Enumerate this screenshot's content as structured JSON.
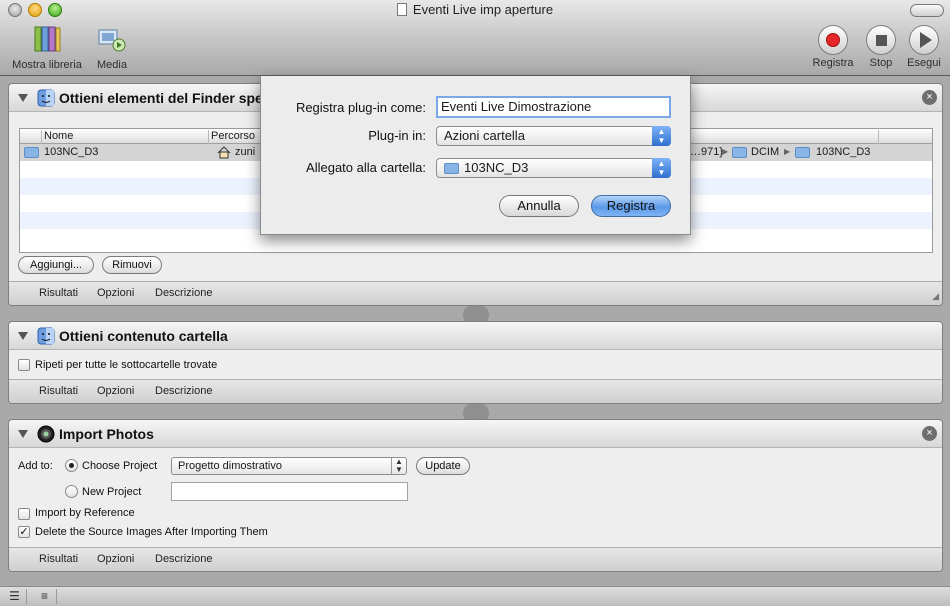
{
  "window": {
    "title": "Eventi Live imp aperture"
  },
  "toolbar": {
    "library_label": "Mostra libreria",
    "media_label": "Media",
    "record_label": "Registra",
    "stop_label": "Stop",
    "run_label": "Esegui"
  },
  "actions": [
    {
      "title": "Ottieni elementi del Finder specificati",
      "columns": [
        "Nome",
        "Percorso"
      ],
      "rows": [
        {
          "name": "103NC_D3",
          "path_start": "zuni",
          "path_mid": "…971}",
          "path_folder1": "DCIM",
          "path_folder2": "103NC_D3"
        }
      ],
      "add_button": "Aggiungi...",
      "remove_button": "Rimuovi"
    },
    {
      "title": "Ottieni contenuto cartella",
      "repeat_label": "Ripeti per tutte le sottocartelle trovate",
      "repeat_checked": false
    },
    {
      "title": "Import Photos",
      "add_to_label": "Add to:",
      "choose_project_label": "Choose Project",
      "project_value": "Progetto dimostrativo",
      "update_button": "Update",
      "new_project_label": "New Project",
      "new_project_value": "",
      "import_by_reference_label": "Import by Reference",
      "delete_source_label": "Delete the Source Images After Importing Them"
    }
  ],
  "footer_tabs": {
    "results": "Risultati",
    "options": "Opzioni",
    "description": "Descrizione"
  },
  "dialog": {
    "name_label": "Registra plug-in come:",
    "name_value": "Eventi Live Dimostrazione",
    "plugin_label": "Plug-in in:",
    "plugin_value": "Azioni cartella",
    "attached_label": "Allegato alla cartella:",
    "attached_value": "103NC_D3",
    "cancel_button": "Annulla",
    "save_button": "Registra"
  },
  "icons": {
    "library": "library-books-icon",
    "media": "media-icon",
    "record": "record-icon",
    "stop": "stop-icon",
    "run": "play-icon",
    "finder": "finder-icon",
    "photos": "aperture-lens-icon",
    "folder": "folder-icon",
    "home": "home-icon"
  },
  "colors": {
    "record_red": "#e5262a",
    "default_button_blue": "#5b9ae8",
    "selection_row": "#d4d4d4"
  }
}
